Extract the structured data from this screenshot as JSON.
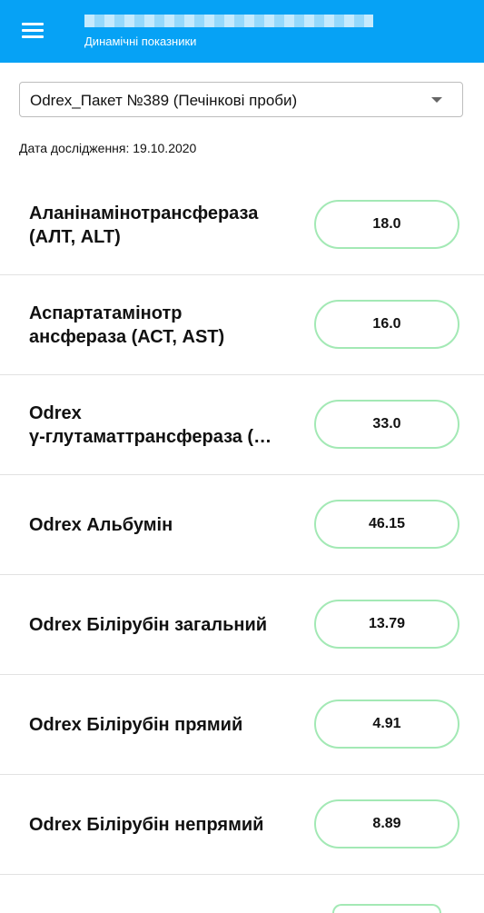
{
  "header": {
    "subtitle": "Динамічні показники",
    "accent_color": "#06a2f5",
    "menu_icon": "hamburger-menu-icon"
  },
  "package_select": {
    "selected": "Odrex_Пакет №389 (Печінкові проби)",
    "arrow_icon": "dropdown-arrow-icon"
  },
  "study_date": "Дата дослідження: 19.10.2020",
  "indicators": [
    {
      "label": "Аланінамінотрансфераза\n(АЛТ, ALT)",
      "value": "18.0"
    },
    {
      "label": "Аспартатамінотр\nансфераза (АСТ, AST)",
      "value": "16.0"
    },
    {
      "label": "Odrex\nγ-глутаматтрансфераза (…",
      "value": "33.0"
    },
    {
      "label": "Odrex Альбумін",
      "value": "46.15"
    },
    {
      "label": "Odrex Білірубін загальний",
      "value": "13.79"
    },
    {
      "label": "Odrex Білірубін прямий",
      "value": "4.91"
    },
    {
      "label": "Odrex Білірубін непрямий",
      "value": "8.89"
    }
  ],
  "pill_border_color": "#a3e9b5"
}
